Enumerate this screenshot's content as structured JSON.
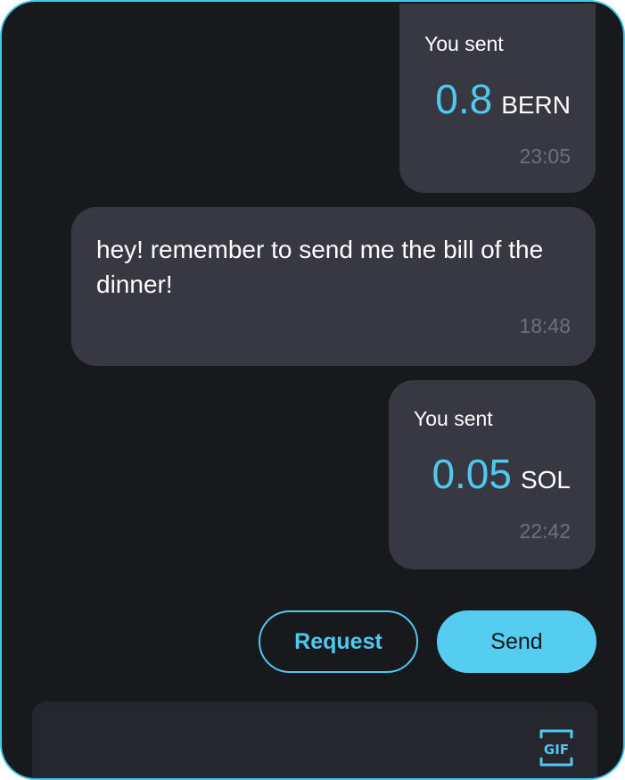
{
  "messages": [
    {
      "kind": "transaction",
      "direction": "sent",
      "label": "You sent",
      "amount": "0.8",
      "currency": "BERN",
      "time": "23:05"
    },
    {
      "kind": "text",
      "direction": "received",
      "text": "hey! remember to send me the bill of the dinner!",
      "time": "18:48"
    },
    {
      "kind": "transaction",
      "direction": "sent",
      "label": "You sent",
      "amount": "0.05",
      "currency": "SOL",
      "time": "22:42"
    }
  ],
  "actions": {
    "request_label": "Request",
    "send_label": "Send"
  },
  "composer": {
    "gif_icon": "gif-icon",
    "gif_text": "GIF"
  },
  "colors": {
    "background": "#18191d",
    "bubble": "#383842",
    "accent": "#4fc9ef",
    "timestamp": "#6f6f7a"
  }
}
